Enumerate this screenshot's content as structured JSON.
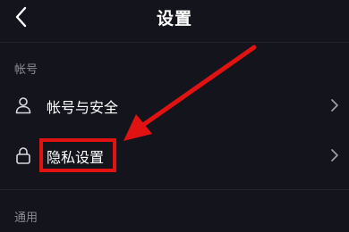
{
  "nav": {
    "title": "设置",
    "back_icon": "chevron-left-icon"
  },
  "sections": {
    "account": {
      "header": "帐号",
      "items": [
        {
          "label": "帐号与安全",
          "icon": "user-icon"
        },
        {
          "label": "隐私设置",
          "icon": "lock-icon"
        }
      ]
    },
    "general": {
      "header": "通用"
    }
  },
  "colors": {
    "background": "#14151c",
    "text": "#ffffff",
    "muted_text": "#8a8b93",
    "annotation": "#e01212"
  }
}
